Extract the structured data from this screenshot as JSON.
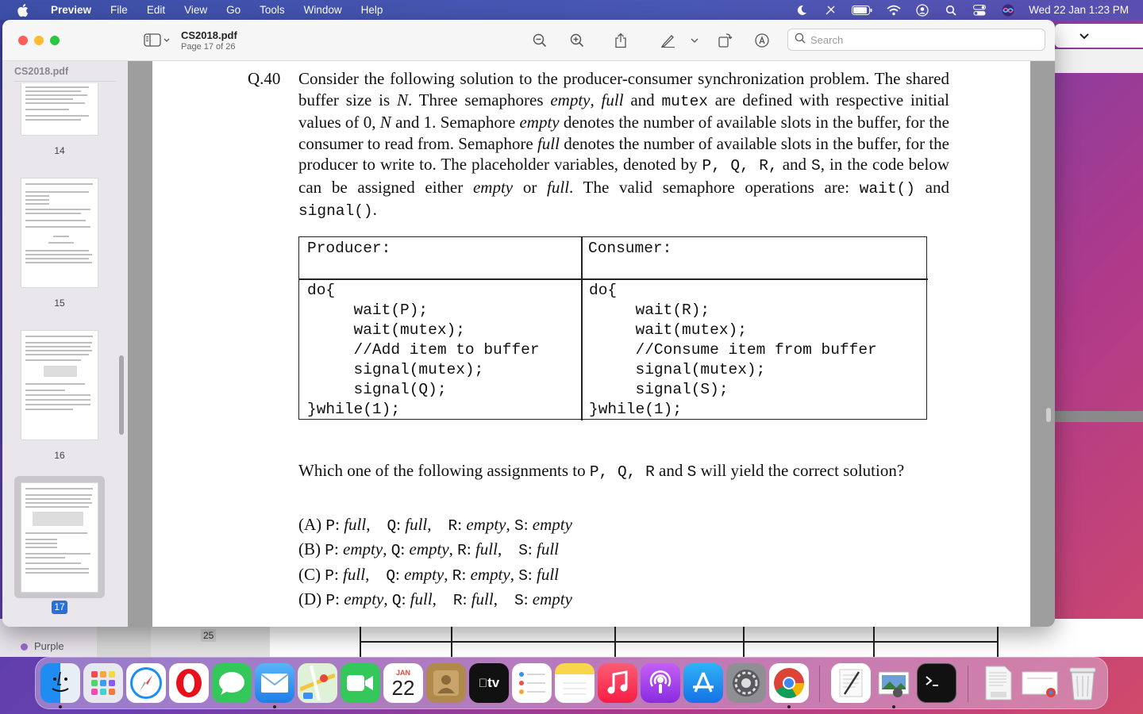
{
  "menubar": {
    "app_name": "Preview",
    "items": [
      "File",
      "Edit",
      "View",
      "Go",
      "Tools",
      "Window",
      "Help"
    ],
    "clock": "Wed 22 Jan  1:23 PM"
  },
  "window": {
    "title": "CS2018.pdf",
    "subtitle": "Page 17 of 26",
    "search_placeholder": "Search"
  },
  "sidebar": {
    "title": "CS2018.pdf",
    "pages": [
      {
        "label": "14"
      },
      {
        "label": "15"
      },
      {
        "label": "16"
      },
      {
        "label": "17",
        "selected": true
      }
    ]
  },
  "document": {
    "question_number": "Q.40",
    "question_text": {
      "s1": "Consider the following solution to the producer-consumer synchronization problem. The shared buffer size is ",
      "N1": "N",
      "s2": ". Three semaphores ",
      "empty1": "empty",
      "comma1": ", ",
      "full1": "full",
      "and1": " and ",
      "mutex1": "mutex",
      "s3": " are defined with respective initial values of 0, ",
      "N2": "N",
      "s4": " and 1. Semaphore ",
      "empty2": "empty",
      "s5": " denotes the number of available slots in the buffer, for the consumer to read from. Semaphore ",
      "full2": "full",
      "s6": " denotes the number of available slots in the buffer, for the producer to write to. The placeholder variables, denoted by ",
      "pqr": "P,  Q,  R,",
      "and2": " and ",
      "S": "S",
      "s7": ", in the code below can be assigned either ",
      "empty3": "empty",
      "or": " or ",
      "full3": "full",
      "s8": ". The valid semaphore operations are: ",
      "wait": "wait()",
      "and3": " and ",
      "signal": "signal()",
      "end": "."
    },
    "table": {
      "producer_header": "Producer:",
      "consumer_header": "Consumer:",
      "producer_code": "do{\n     wait(P);\n     wait(mutex);\n     //Add item to buffer\n     signal(mutex);\n     signal(Q);\n}while(1);",
      "consumer_code": "do{\n     wait(R);\n     wait(mutex);\n     //Consume item from buffer\n     signal(mutex);\n     signal(S);\n}while(1);"
    },
    "which": {
      "pre": "Which one of the following assignments to ",
      "vars": "P,  Q,  R",
      "and": " and ",
      "s": "S",
      "post": " will yield the correct solution?"
    },
    "options": [
      {
        "letter": "(A) ",
        "p": "P",
        "pv": "full",
        "q": "Q",
        "qv": "full",
        "r": "R",
        "rv": "empty",
        "s": "S",
        "sv": "empty"
      },
      {
        "letter": "(B) ",
        "p": "P",
        "pv": "empty",
        "q": "Q",
        "qv": "empty",
        "r": "R",
        "rv": "full",
        "s": "S",
        "sv": "full"
      },
      {
        "letter": "(C) ",
        "p": "P",
        "pv": "full",
        "q": "Q",
        "qv": "empty",
        "r": "R",
        "rv": "empty",
        "s": "S",
        "sv": "full"
      },
      {
        "letter": "(D) ",
        "p": "P",
        "pv": "empty",
        "q": "Q",
        "qv": "full",
        "r": "R",
        "rv": "full",
        "s": "S",
        "sv": "empty"
      }
    ]
  },
  "background": {
    "purple_label": "Purple",
    "number": "25"
  },
  "dock": {
    "calendar_month": "JAN",
    "calendar_day": "22",
    "apps": [
      "finder-icon",
      "launchpad-icon",
      "safari-icon",
      "opera-icon",
      "messages-icon",
      "mail-icon",
      "maps-icon",
      "facetime-icon",
      "calendar-icon",
      "contacts-icon",
      "apple-tv-icon",
      "reminders-icon",
      "notes-icon",
      "music-icon",
      "podcasts-icon",
      "app-store-icon",
      "system-preferences-icon",
      "chrome-icon",
      "textedit-icon",
      "preview-icon",
      "terminal-icon",
      "pdf-document-icon",
      "chrome-document-icon",
      "trash-icon"
    ],
    "tv_label": "tv"
  },
  "colors": {
    "accent": "#2a6fd8",
    "menubar": "#4a58b5"
  }
}
